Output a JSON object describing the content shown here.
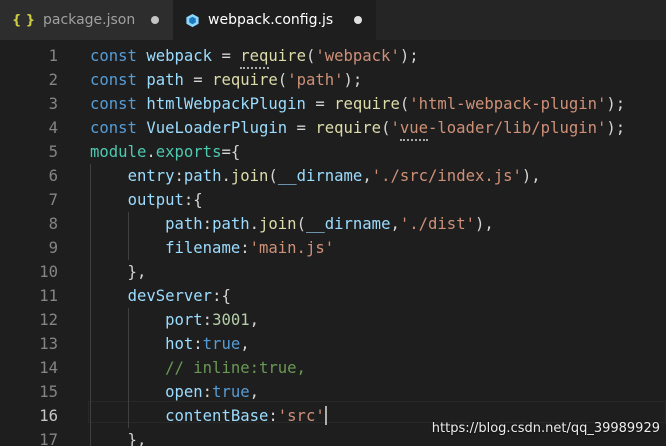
{
  "tabs": [
    {
      "label": "package.json",
      "icon": "json-braces-icon",
      "active": false,
      "dirty": true
    },
    {
      "label": "webpack.config.js",
      "icon": "webpack-cube-icon",
      "active": true,
      "dirty": true
    }
  ],
  "current_line": 16,
  "lines": [
    {
      "n": "1",
      "tokens": [
        [
          "kw",
          "const "
        ],
        [
          "var",
          "webpack"
        ],
        [
          "pun",
          " = "
        ],
        [
          "fn",
          "require"
        ],
        [
          "pun",
          "("
        ],
        [
          "str",
          "'webpack'"
        ],
        [
          "pun",
          ");"
        ]
      ]
    },
    {
      "n": "2",
      "tokens": [
        [
          "kw",
          "const "
        ],
        [
          "var",
          "path"
        ],
        [
          "pun",
          " = "
        ],
        [
          "fn",
          "require"
        ],
        [
          "pun",
          "("
        ],
        [
          "str",
          "'path'"
        ],
        [
          "pun",
          ");"
        ]
      ]
    },
    {
      "n": "3",
      "tokens": [
        [
          "kw",
          "const "
        ],
        [
          "var",
          "htmlWebpackPlugin"
        ],
        [
          "pun",
          " = "
        ],
        [
          "fn",
          "require"
        ],
        [
          "pun",
          "("
        ],
        [
          "str",
          "'html-webpack-plugin'"
        ],
        [
          "pun",
          ");"
        ]
      ]
    },
    {
      "n": "4",
      "tokens": [
        [
          "kw",
          "const "
        ],
        [
          "var",
          "VueLoaderPlugin"
        ],
        [
          "pun",
          " = "
        ],
        [
          "fn",
          "require"
        ],
        [
          "pun",
          "("
        ],
        [
          "str",
          "'vue-loader/lib/plugin'"
        ],
        [
          "pun",
          ");"
        ]
      ]
    },
    {
      "n": "5",
      "tokens": [
        [
          "cls",
          "module"
        ],
        [
          "pun",
          "."
        ],
        [
          "cls",
          "exports"
        ],
        [
          "pun",
          "={"
        ]
      ]
    },
    {
      "n": "6",
      "tokens": [
        [
          "pun",
          "    "
        ],
        [
          "var",
          "entry"
        ],
        [
          "pun",
          ":"
        ],
        [
          "var",
          "path"
        ],
        [
          "pun",
          "."
        ],
        [
          "fn",
          "join"
        ],
        [
          "pun",
          "("
        ],
        [
          "var",
          "__dirname"
        ],
        [
          "pun",
          ","
        ],
        [
          "str",
          "'./src/index.js'"
        ],
        [
          "pun",
          "),"
        ]
      ]
    },
    {
      "n": "7",
      "tokens": [
        [
          "pun",
          "    "
        ],
        [
          "var",
          "output"
        ],
        [
          "pun",
          ":{"
        ]
      ]
    },
    {
      "n": "8",
      "tokens": [
        [
          "pun",
          "        "
        ],
        [
          "var",
          "path"
        ],
        [
          "pun",
          ":"
        ],
        [
          "var",
          "path"
        ],
        [
          "pun",
          "."
        ],
        [
          "fn",
          "join"
        ],
        [
          "pun",
          "("
        ],
        [
          "var",
          "__dirname"
        ],
        [
          "pun",
          ","
        ],
        [
          "str",
          "'./dist'"
        ],
        [
          "pun",
          "),"
        ]
      ]
    },
    {
      "n": "9",
      "tokens": [
        [
          "pun",
          "        "
        ],
        [
          "var",
          "filename"
        ],
        [
          "pun",
          ":"
        ],
        [
          "str",
          "'main.js'"
        ]
      ]
    },
    {
      "n": "10",
      "tokens": [
        [
          "pun",
          "    },"
        ]
      ]
    },
    {
      "n": "11",
      "tokens": [
        [
          "pun",
          "    "
        ],
        [
          "var",
          "devServer"
        ],
        [
          "pun",
          ":{"
        ]
      ]
    },
    {
      "n": "12",
      "tokens": [
        [
          "pun",
          "        "
        ],
        [
          "var",
          "port"
        ],
        [
          "pun",
          ":"
        ],
        [
          "num",
          "3001"
        ],
        [
          "pun",
          ","
        ]
      ]
    },
    {
      "n": "13",
      "tokens": [
        [
          "pun",
          "        "
        ],
        [
          "var",
          "hot"
        ],
        [
          "pun",
          ":"
        ],
        [
          "kw",
          "true"
        ],
        [
          "pun",
          ","
        ]
      ]
    },
    {
      "n": "14",
      "tokens": [
        [
          "pun",
          "        "
        ],
        [
          "cm",
          "// inline:true,"
        ]
      ]
    },
    {
      "n": "15",
      "tokens": [
        [
          "pun",
          "        "
        ],
        [
          "var",
          "open"
        ],
        [
          "pun",
          ":"
        ],
        [
          "kw",
          "true"
        ],
        [
          "pun",
          ","
        ]
      ]
    },
    {
      "n": "16",
      "tokens": [
        [
          "pun",
          "        "
        ],
        [
          "var",
          "contentBase"
        ],
        [
          "pun",
          ":"
        ],
        [
          "str",
          "'src'"
        ]
      ]
    },
    {
      "n": "17",
      "tokens": [
        [
          "pun",
          "    },"
        ]
      ]
    }
  ],
  "watermark": "https://blog.csdn.net/qq_39989929",
  "colors": {
    "background": "#1e1e1e",
    "tabbar": "#252526",
    "keyword": "#569cd6",
    "variable": "#9cdcfe",
    "function": "#dcdcaa",
    "string": "#ce9178",
    "number": "#b5cea8",
    "comment": "#6a9955"
  }
}
